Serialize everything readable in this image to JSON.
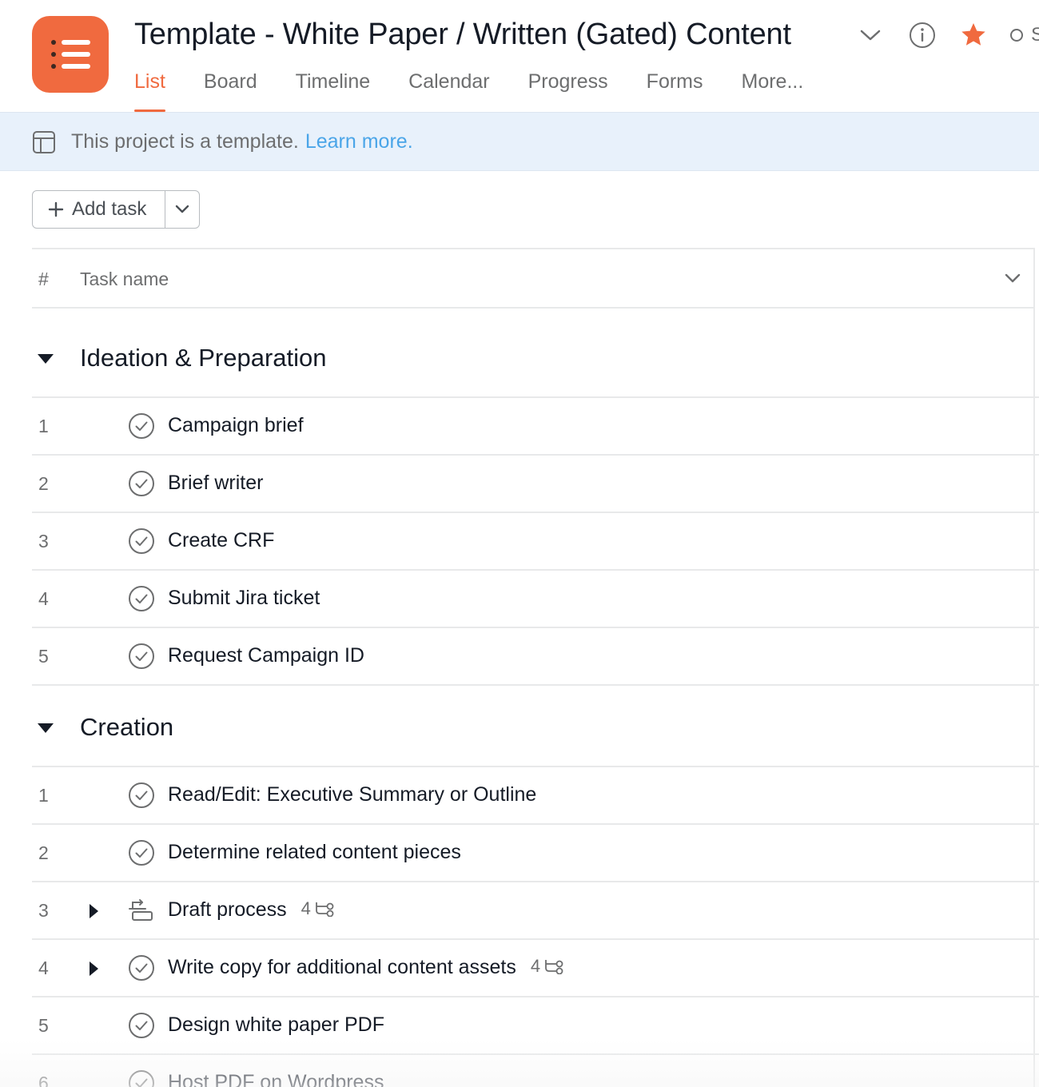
{
  "header": {
    "title": "Template - White Paper / Written (Gated) Content",
    "status_text": "S",
    "tabs": [
      {
        "label": "List",
        "active": true
      },
      {
        "label": "Board",
        "active": false
      },
      {
        "label": "Timeline",
        "active": false
      },
      {
        "label": "Calendar",
        "active": false
      },
      {
        "label": "Progress",
        "active": false
      },
      {
        "label": "Forms",
        "active": false
      },
      {
        "label": "More..."
      }
    ],
    "brand_color": "#f06a3f",
    "star_color": "#f06a3f"
  },
  "banner": {
    "text": "This project is a template.",
    "link": "Learn more."
  },
  "toolbar": {
    "add_task_label": "Add task"
  },
  "table": {
    "hash_header": "#",
    "name_header": "Task name"
  },
  "sections": [
    {
      "title": "Ideation & Preparation",
      "tasks": [
        {
          "num": "1",
          "name": "Campaign brief"
        },
        {
          "num": "2",
          "name": "Brief writer"
        },
        {
          "num": "3",
          "name": "Create CRF"
        },
        {
          "num": "4",
          "name": "Submit Jira ticket"
        },
        {
          "num": "5",
          "name": "Request Campaign ID"
        }
      ]
    },
    {
      "title": "Creation",
      "tasks": [
        {
          "num": "1",
          "name": "Read/Edit: Executive Summary or Outline"
        },
        {
          "num": "2",
          "name": "Determine related content pieces"
        },
        {
          "num": "3",
          "name": "Draft process",
          "subtasks": "4"
        },
        {
          "num": "4",
          "name": "Write copy for additional content assets",
          "subtasks": "4"
        },
        {
          "num": "5",
          "name": "Design white paper PDF"
        },
        {
          "num": "6",
          "name": "Host PDF on Wordpress"
        }
      ]
    }
  ]
}
